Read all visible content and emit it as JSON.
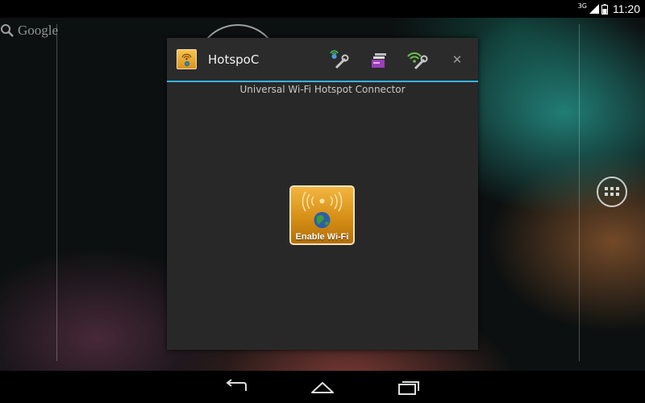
{
  "status_bar": {
    "network_type": "3G",
    "time": "11:20"
  },
  "home_screen": {
    "search_label": "Google"
  },
  "dialog": {
    "title": "HotspoC",
    "subtitle": "Universal Wi-Fi Hotspot Connector",
    "enable_button_label": "Enable Wi-Fi",
    "close_label": "✕"
  },
  "colors": {
    "accent": "#33b5e5",
    "button_gold": "#d68f16",
    "dialog_bg": "#282828"
  },
  "icons": {
    "header": [
      "hotspot-settings-icon",
      "hotspot-list-icon",
      "wifi-settings-icon"
    ],
    "nav": [
      "back-icon",
      "home-icon",
      "recent-apps-icon"
    ]
  }
}
